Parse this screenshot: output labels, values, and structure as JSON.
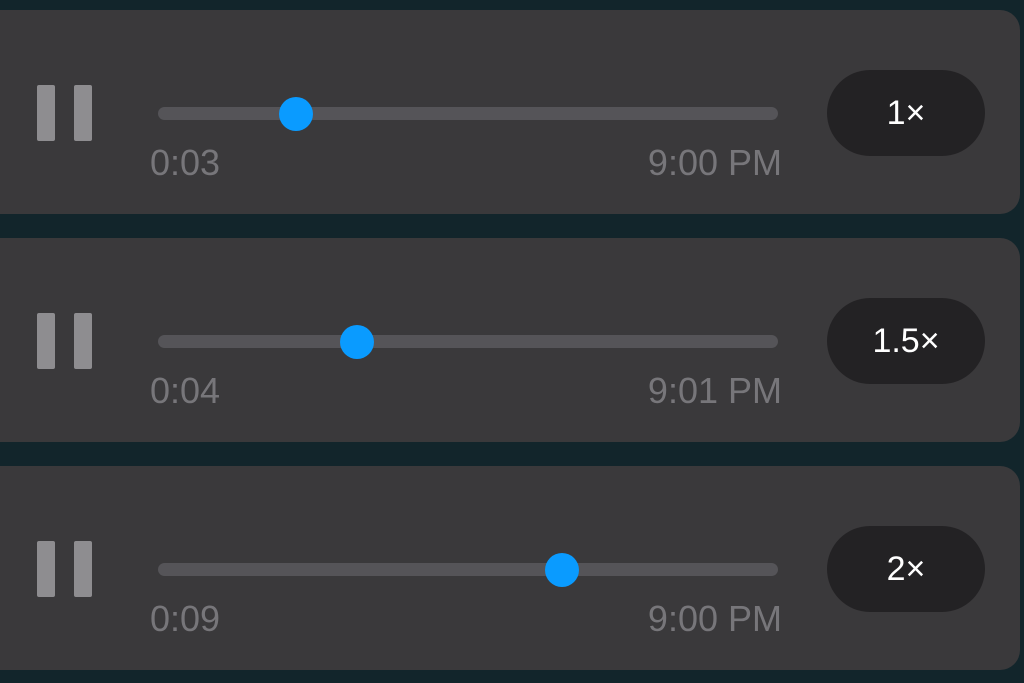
{
  "messages": [
    {
      "elapsed": "0:03",
      "timestamp": "9:00 PM",
      "speed": "1×",
      "progress": 0.222
    },
    {
      "elapsed": "0:04",
      "timestamp": "9:01 PM",
      "speed": "1.5×",
      "progress": 0.321
    },
    {
      "elapsed": "0:09",
      "timestamp": "9:00 PM",
      "speed": "2×",
      "progress": 0.652
    }
  ],
  "colors": {
    "background": "#12252b",
    "bubble": "#3a393b",
    "track": "#555458",
    "accent": "#0a9bff",
    "muted_text": "#77767a",
    "pill": "#232224"
  },
  "icons": {
    "pause": "pause-icon"
  }
}
